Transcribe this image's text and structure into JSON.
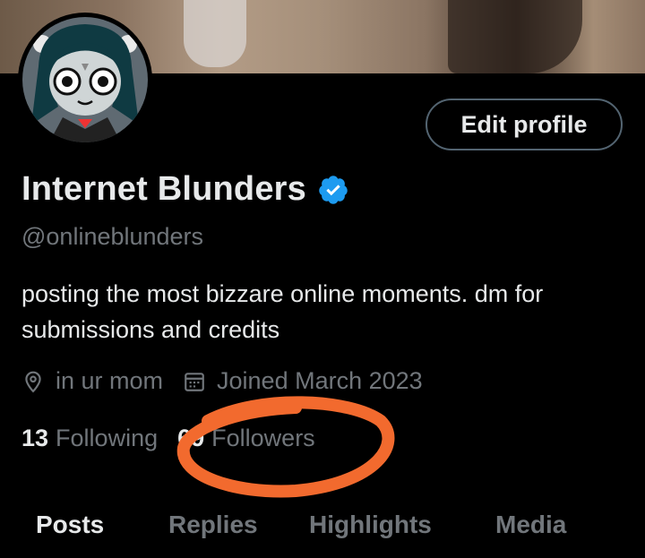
{
  "profile": {
    "display_name": "Internet Blunders",
    "handle": "@onlineblunders",
    "bio": "posting the most bizzare online moments. dm for submissions and credits",
    "location": "in ur mom",
    "joined": "Joined March 2023",
    "edit_profile_label": "Edit profile"
  },
  "stats": {
    "following_count": "13",
    "following_label": "Following",
    "followers_count": "69",
    "followers_label": "Followers"
  },
  "tabs": [
    {
      "label": "Posts",
      "active": true
    },
    {
      "label": "Replies",
      "active": false
    },
    {
      "label": "Highlights",
      "active": false
    },
    {
      "label": "Media",
      "active": false
    }
  ],
  "colors": {
    "background": "#000000",
    "primary_text": "#e7e9ea",
    "secondary_text": "#71767b",
    "verified_blue": "#1d9bf0",
    "annotation_orange": "#f26a2e"
  },
  "icons": {
    "verified": "verified-badge-icon",
    "location": "location-pin-icon",
    "calendar": "calendar-icon"
  }
}
